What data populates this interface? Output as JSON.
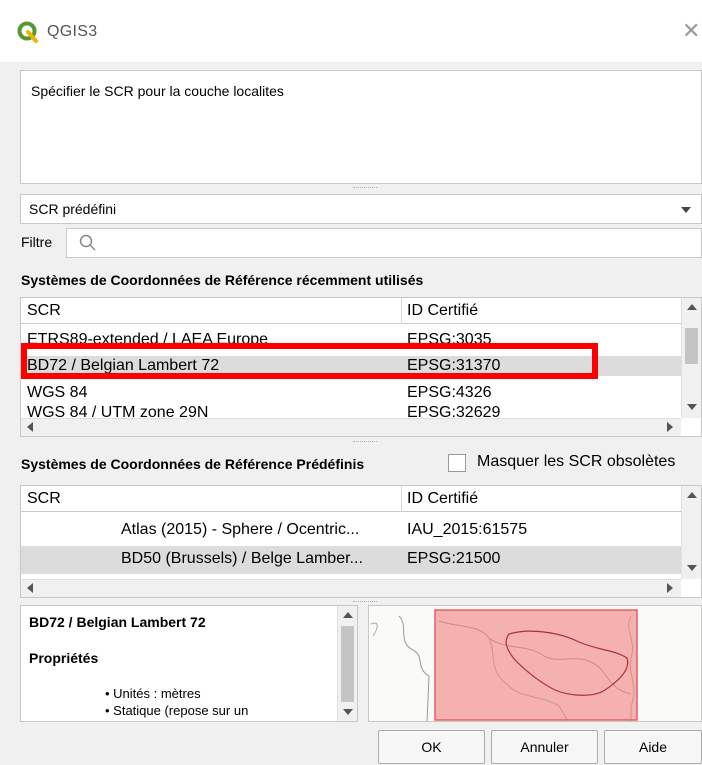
{
  "window": {
    "title": "QGIS3",
    "close_symbol": "✕"
  },
  "message": "Spécifier le SCR pour la couche localites",
  "crs_mode": {
    "selected": "SCR prédéfini"
  },
  "filter": {
    "label": "Filtre",
    "value": ""
  },
  "recent": {
    "heading": "Systèmes de Coordonnées de Référence récemment utilisés",
    "columns": [
      "SCR",
      "ID Certifié"
    ],
    "rows": [
      {
        "name": "ETRS89-extended / LAEA Europe",
        "id": "EPSG:3035"
      },
      {
        "name": "BD72 / Belgian Lambert 72",
        "id": "EPSG:31370",
        "selected": true
      },
      {
        "name": "WGS 84",
        "id": "EPSG:4326"
      },
      {
        "name": "WGS 84 / UTM zone 29N",
        "id": "EPSG:32629"
      }
    ]
  },
  "predefined": {
    "heading": "Systèmes de Coordonnées de Référence Prédéfinis",
    "hide_deprecated_label": "Masquer les SCR obsolètes",
    "hide_deprecated_checked": false,
    "columns": [
      "SCR",
      "ID Certifié"
    ],
    "rows": [
      {
        "name": "Atlas (2015) - Sphere / Ocentric...",
        "id": "IAU_2015:61575"
      },
      {
        "name": "BD50 (Brussels) / Belge Lamber...",
        "id": "EPSG:21500"
      }
    ]
  },
  "details": {
    "title": "BD72 / Belgian Lambert 72",
    "section": "Propriétés",
    "bullets": [
      "• Unités : mètres",
      "• Statique (repose sur un"
    ]
  },
  "buttons": {
    "ok": "OK",
    "cancel": "Annuler",
    "help": "Aide"
  },
  "colors": {
    "highlight": "#ff0000",
    "map_extent": "#f08080",
    "qgis_green": "#589632"
  }
}
